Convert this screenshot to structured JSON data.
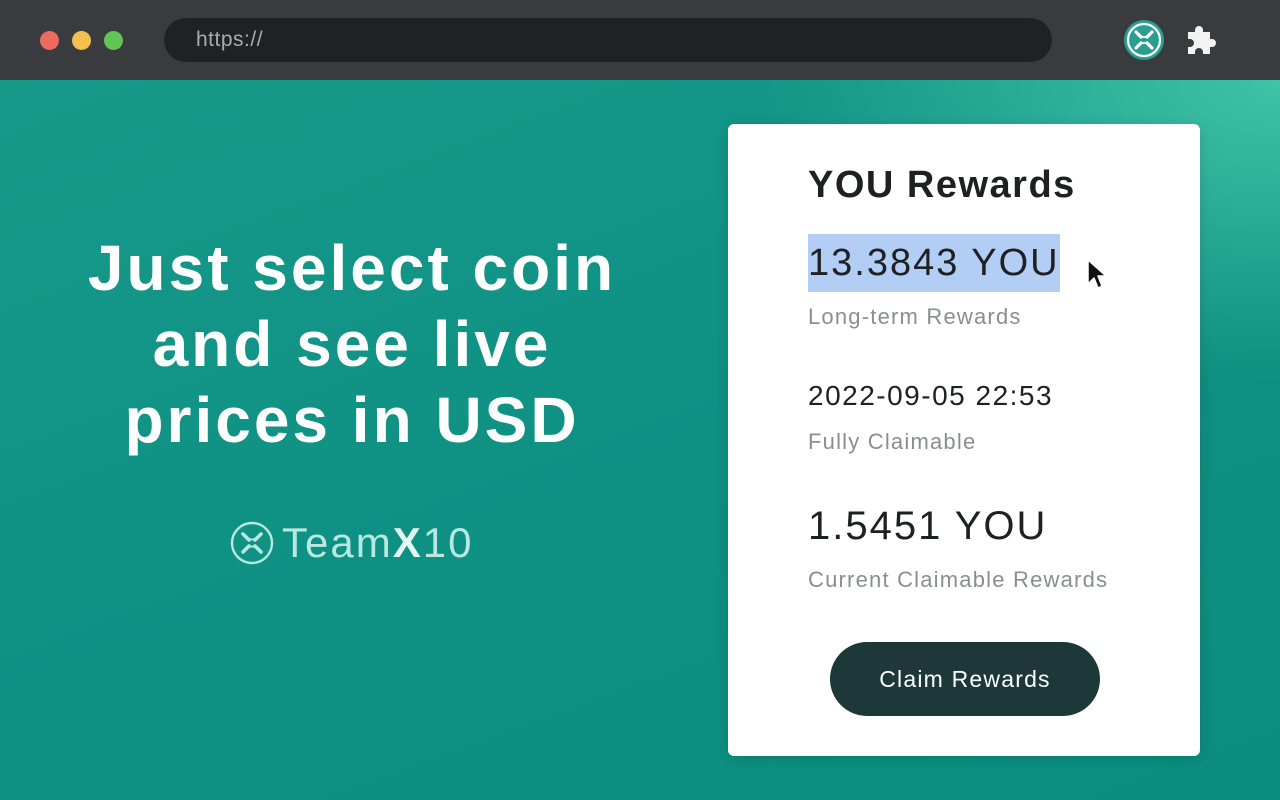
{
  "browser": {
    "url": "https://",
    "window_controls": [
      "close",
      "minimize",
      "maximize"
    ],
    "extension_icon": "teamx10-logo-icon",
    "extensions_icon": "puzzle-icon"
  },
  "hero": {
    "line1": "Just select coin",
    "line2": "and see live",
    "line3": "prices in USD"
  },
  "brand": {
    "name_prefix": "Team",
    "name_x": "X",
    "name_suffix": "10",
    "logo_icon": "teamx10-logo-icon"
  },
  "card": {
    "title": "YOU Rewards",
    "long_term_value": "13.3843 YOU",
    "long_term_label": "Long-term Rewards",
    "claim_date": "2022-09-05 22:53",
    "claim_date_label": "Fully Claimable",
    "current_value": "1.5451 YOU",
    "current_label": "Current Claimable Rewards",
    "claim_button": "Claim Rewards"
  },
  "colors": {
    "accent_teal": "#0f9184",
    "button_dark": "#1e383a",
    "selection": "#b3cef5"
  }
}
